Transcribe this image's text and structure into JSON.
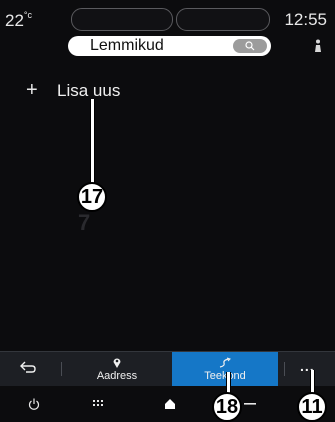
{
  "status_bar": {
    "temperature": "22",
    "temperature_unit": "°c",
    "time": "12:55",
    "profile_icon": "person-seat-icon"
  },
  "header": {
    "title": "Lemmikud",
    "search_icon": "search-icon"
  },
  "list": {
    "add_new_label": "Lisa uus",
    "add_icon": "plus-icon",
    "faded_digit": "7"
  },
  "callouts": {
    "c17": "17",
    "c18": "18",
    "c11": "11"
  },
  "nav": {
    "back_icon": "back-arrow-icon",
    "tabs": [
      {
        "label": "Aadress",
        "icon": "location-pin-icon",
        "active": false
      },
      {
        "label": "Teekond",
        "icon": "route-icon",
        "active": true
      }
    ],
    "more_label": "...",
    "active_color": "#1577c7"
  },
  "system_bar": {
    "icons": [
      "power-icon",
      "apps-grid-icon",
      "home-icon",
      "minus-icon"
    ]
  }
}
